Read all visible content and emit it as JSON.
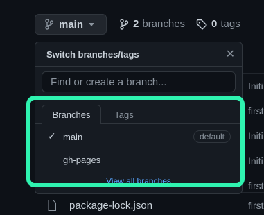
{
  "toolbar": {
    "branch_button_label": "main",
    "branches_count": "2",
    "branches_label": "branches",
    "tags_count": "0",
    "tags_label": "tags"
  },
  "dropdown": {
    "title": "Switch branches/tags",
    "close_symbol": "✕",
    "search_placeholder": "Find or create a branch...",
    "tabs": [
      {
        "label": "Branches",
        "active": true
      },
      {
        "label": "Tags",
        "active": false
      }
    ],
    "branches": [
      {
        "name": "main",
        "selected": true,
        "badge": "default"
      },
      {
        "name": "gh-pages",
        "selected": false,
        "badge": ""
      }
    ],
    "view_all_label": "View all branches"
  },
  "file_list": {
    "commit_snippets": [
      "Initi",
      "first",
      "Initi",
      "Initi",
      "first",
      "first"
    ],
    "visible_file": "package-lock.json",
    "visible_file_commit": "first"
  },
  "colors": {
    "background": "#0d1117",
    "highlight": "#2ff3b0",
    "link": "#58a6ff"
  },
  "icons": [
    "git-branch-icon",
    "tag-icon",
    "check-icon",
    "close-icon",
    "file-icon",
    "caret-down-icon"
  ]
}
